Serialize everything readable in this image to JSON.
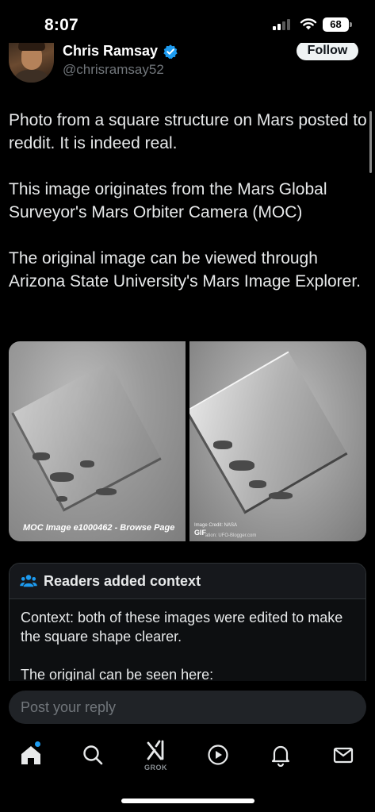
{
  "status_bar": {
    "time": "8:07",
    "battery": "68"
  },
  "author": {
    "name": "Chris Ramsay",
    "handle": "@chrisramsay52",
    "follow_label": "Follow"
  },
  "post": {
    "paragraphs": [
      "Photo from a square structure on Mars posted to reddit. It is indeed real.",
      "This image originates from the Mars Global Surveyor's Mars Orbiter Camera (MOC)",
      "The original image can be viewed through Arizona State University's Mars Image Explorer."
    ],
    "media": {
      "left_caption": "MOC Image e1000462 - Browse Page",
      "right_credit": "Image Credit: NASA",
      "right_gif": "GIF",
      "right_credit2": "ation: UFO-Blogger.com"
    }
  },
  "context": {
    "title": "Readers added context",
    "paragraphs": [
      "Context: both of these images were edited to make the square shape clearer.",
      "The original can be seen here:"
    ]
  },
  "reply": {
    "placeholder": "Post your reply"
  },
  "tabbar": {
    "grok_label": "GROK"
  },
  "colors": {
    "accent": "#1d9bf0",
    "background": "#000000",
    "text": "#e7e9ea",
    "muted": "#71767b"
  },
  "icons": [
    "signal-icon",
    "wifi-icon",
    "battery-icon",
    "verified-badge-icon",
    "people-icon",
    "home-icon",
    "search-icon",
    "grok-icon",
    "video-icon",
    "bell-icon",
    "mail-icon"
  ]
}
